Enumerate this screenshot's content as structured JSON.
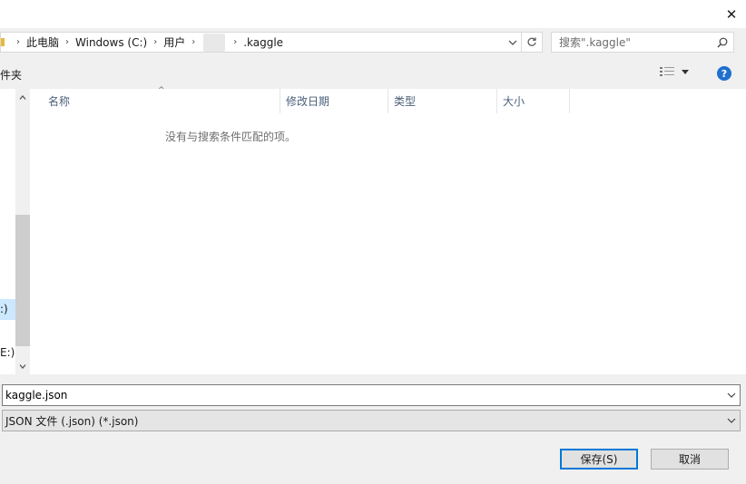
{
  "dialog": {
    "close_glyph": "✕"
  },
  "address_bar": {
    "breadcrumbs": [
      "此电脑",
      "Windows (C:)",
      "用户",
      ".kaggle"
    ],
    "separator": "›",
    "dropdown_icon": "chevron-down-icon",
    "refresh_icon": "refresh-icon"
  },
  "search": {
    "placeholder": "搜索\".kaggle\"",
    "icon": "search-icon"
  },
  "toolbar": {
    "new_folder_fragment": "件夹",
    "view_icon": "view-options-icon",
    "help_label": "?"
  },
  "nav_pane": {
    "items": [
      ":)",
      "E:)"
    ]
  },
  "file_list": {
    "columns": [
      "名称",
      "修改日期",
      "类型",
      "大小"
    ],
    "sort_column": "名称",
    "empty_message": "没有与搜索条件匹配的项。"
  },
  "bottom": {
    "filename_value": "kaggle.json",
    "filetype_value": "JSON 文件 (.json) (*.json)",
    "save_label": "保存(S)",
    "cancel_label": "取消"
  },
  "colors": {
    "accent": "#0078d7",
    "help_blue": "#1f6fd0",
    "selection": "#cce8ff",
    "folder": "#e9b93a"
  }
}
